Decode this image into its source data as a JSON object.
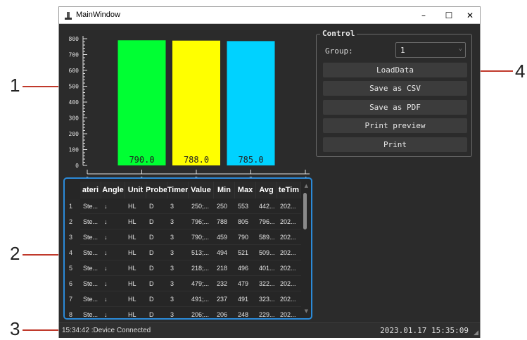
{
  "window": {
    "title": "MainWindow",
    "minimize": "–",
    "maximize": "☐",
    "close": "✕"
  },
  "callouts": [
    "1",
    "2",
    "3",
    "4"
  ],
  "chart_data": {
    "type": "bar",
    "x_ticks": [
      "0",
      "1",
      "2",
      "3",
      "4"
    ],
    "y_ticks": [
      "0",
      "100",
      "200",
      "300",
      "400",
      "500",
      "600",
      "700",
      "800"
    ],
    "ylim": [
      0,
      800
    ],
    "xlim": [
      0,
      4
    ],
    "bars": [
      {
        "x": 1,
        "value": 790.0,
        "label": "790.0",
        "color": "#00ff33"
      },
      {
        "x": 2,
        "value": 788.0,
        "label": "788.0",
        "color": "#ffff00"
      },
      {
        "x": 3,
        "value": 785.0,
        "label": "785.0",
        "color": "#00d2ff"
      }
    ],
    "background": "#2b2b2b",
    "axis_color": "#e0e0e0"
  },
  "control": {
    "legend": "Control",
    "group_label": "Group:",
    "group_value": "1",
    "buttons": [
      "LoadData",
      "Save as CSV",
      "Save as PDF",
      "Print preview",
      "Print"
    ]
  },
  "table": {
    "columns": [
      "ateri",
      "Angle",
      "Unit",
      "Probe",
      "Timer",
      "Value",
      "Min",
      "Max",
      "Avg",
      "teTim"
    ],
    "rows": [
      [
        "1",
        "Ste...",
        "↓",
        "HL",
        "D",
        "3",
        "250;...",
        "250",
        "553",
        "442...",
        "202..."
      ],
      [
        "2",
        "Ste...",
        "↓",
        "HL",
        "D",
        "3",
        "796;...",
        "788",
        "805",
        "796...",
        "202..."
      ],
      [
        "3",
        "Ste...",
        "↓",
        "HL",
        "D",
        "3",
        "790;...",
        "459",
        "790",
        "589...",
        "202..."
      ],
      [
        "4",
        "Ste...",
        "↓",
        "HL",
        "D",
        "3",
        "513;...",
        "494",
        "521",
        "509...",
        "202..."
      ],
      [
        "5",
        "Ste...",
        "↓",
        "HL",
        "D",
        "3",
        "218;...",
        "218",
        "496",
        "401...",
        "202..."
      ],
      [
        "6",
        "Ste...",
        "↓",
        "HL",
        "D",
        "3",
        "479;...",
        "232",
        "479",
        "322...",
        "202..."
      ],
      [
        "7",
        "Ste...",
        "↓",
        "HL",
        "D",
        "3",
        "491;...",
        "237",
        "491",
        "323...",
        "202..."
      ],
      [
        "8",
        "Ste...",
        "↓",
        "HL",
        "D",
        "3",
        "206;...",
        "206",
        "248",
        "229...",
        "202..."
      ]
    ],
    "scroll_up": "▲",
    "scroll_down": "▼"
  },
  "status": {
    "left": "15:34:42 :Device Connected",
    "right": "2023.01.17 15:35:09",
    "grip": "◢"
  },
  "colors": {
    "accent": "#2b8ad8",
    "callout_line": "#c0392b"
  }
}
